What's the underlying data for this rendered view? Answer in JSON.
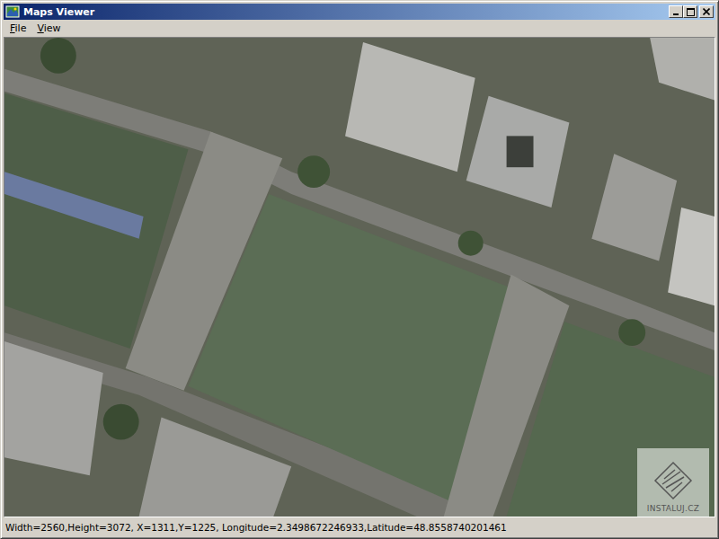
{
  "window": {
    "title": "Maps Viewer"
  },
  "menu": [
    {
      "label": "File"
    },
    {
      "label": "View"
    }
  ],
  "watermark": {
    "text": "INSTALUJ.CZ"
  },
  "status_bar": "Width=2560,Height=3072, X=1311,Y=1225, Longitude=2.3498672246933,Latitude=48.8558740201461"
}
